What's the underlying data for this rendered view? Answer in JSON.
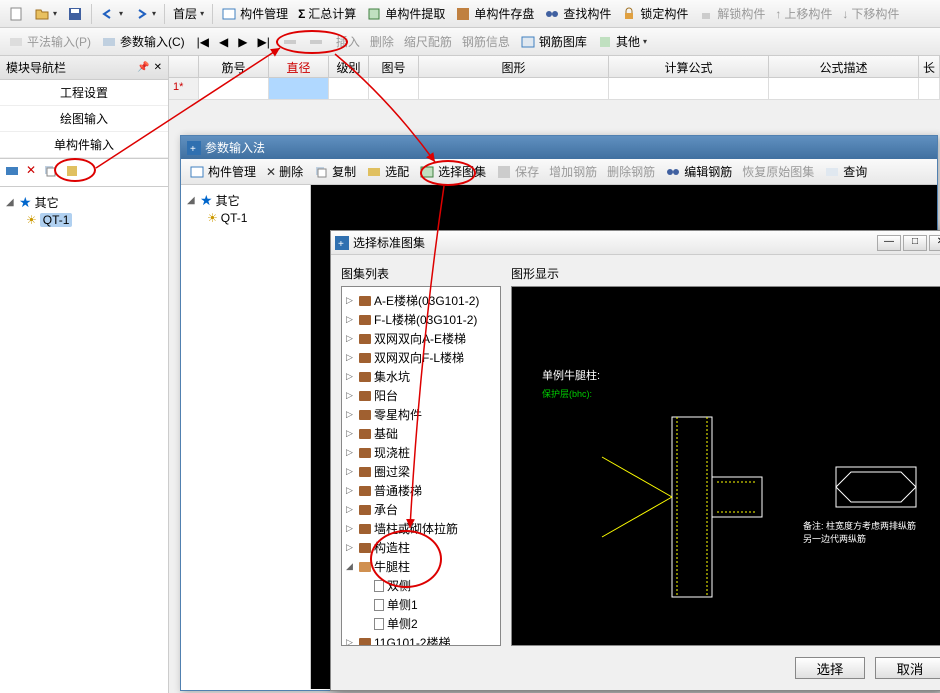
{
  "toolbar": {
    "floor_label": "首层",
    "items": [
      "构件管理",
      "汇总计算",
      "单构件提取",
      "单构件存盘",
      "查找构件",
      "锁定构件",
      "解锁构件",
      "上移构件",
      "下移构件"
    ]
  },
  "subtoolbar": {
    "items": [
      "平法输入(P)",
      "参数输入(C)"
    ],
    "nav": [
      "|◀",
      "◀",
      "▶",
      "▶|"
    ],
    "actions": [
      "插入",
      "删除",
      "缩尺配筋",
      "钢筋信息",
      "钢筋图库",
      "其他"
    ]
  },
  "left_panel": {
    "title": "模块导航栏",
    "nav": [
      "工程设置",
      "绘图输入",
      "单构件输入"
    ],
    "tree": {
      "root": "其它",
      "child": "QT-1"
    }
  },
  "grid": {
    "headers": [
      "",
      "筋号",
      "直径(mm)",
      "级别",
      "图号",
      "图形",
      "计算公式",
      "公式描述",
      "长"
    ],
    "row1_marker": "1*"
  },
  "param_window": {
    "title": "参数输入法",
    "toolbar": [
      "构件管理",
      "删除",
      "复制",
      "选配",
      "选择图集",
      "保存",
      "增加钢筋",
      "删除钢筋",
      "编辑钢筋",
      "恢复原始图集",
      "查询"
    ],
    "tree": {
      "root": "其它",
      "child": "QT-1"
    }
  },
  "atlas_window": {
    "title": "选择标准图集",
    "list_title": "图集列表",
    "preview_title": "图形显示",
    "items": [
      "A-E楼梯(03G101-2)",
      "F-L楼梯(03G101-2)",
      "双网双向A-E楼梯",
      "双网双向F-L楼梯",
      "集水坑",
      "阳台",
      "零星构件",
      "基础",
      "现浇桩",
      "圈过梁",
      "普通楼梯",
      "承台",
      "墙柱或砌体拉筋",
      "构造柱",
      "牛腿柱",
      "11G101-2楼梯"
    ],
    "subitems": [
      "双侧",
      "单侧1",
      "单侧2"
    ],
    "preview_label": "单例牛腿柱:",
    "preview_sub": "保护层(bhc):",
    "preview_note": "备注: 柱宽度方考虑两排纵筋\n另一边代两纵筋",
    "btn_ok": "选择",
    "btn_cancel": "取消"
  }
}
